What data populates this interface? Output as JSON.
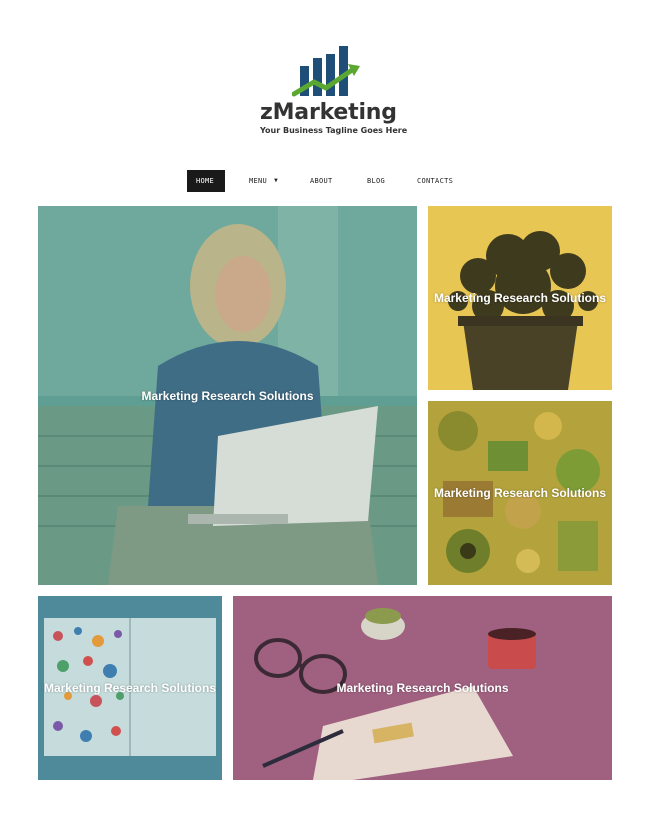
{
  "brand": {
    "name": "zMarketing",
    "tagline": "Your Business Tagline Goes Here",
    "colors": {
      "bars": "#1f4e79",
      "arrow": "#5aa832",
      "text": "#333333"
    }
  },
  "nav": {
    "items": [
      {
        "label": "HOME",
        "active": true
      },
      {
        "label": "MENU",
        "active": false,
        "has_dropdown": true,
        "dropdown_icon": "caret-down-icon"
      },
      {
        "label": "ABOUT",
        "active": false
      },
      {
        "label": "BLOG",
        "active": false
      },
      {
        "label": "CONTACTS",
        "active": false
      }
    ]
  },
  "tiles": [
    {
      "caption": "Marketing Research Solutions",
      "photo": "woman with laptop",
      "overlay": "#5aa79a"
    },
    {
      "caption": "Marketing Research Solutions",
      "photo": "potted plant",
      "overlay": "#e8c24f"
    },
    {
      "caption": "Marketing Research Solutions",
      "photo": "illustrated objects collage",
      "overlay": "#b9a63a"
    },
    {
      "caption": "Marketing Research Solutions",
      "photo": "open book with dots",
      "overlay": "#4f8f9c"
    },
    {
      "caption": "Marketing Research Solutions",
      "photo": "desk with glasses and coffee",
      "overlay": "#9a5a86"
    }
  ]
}
